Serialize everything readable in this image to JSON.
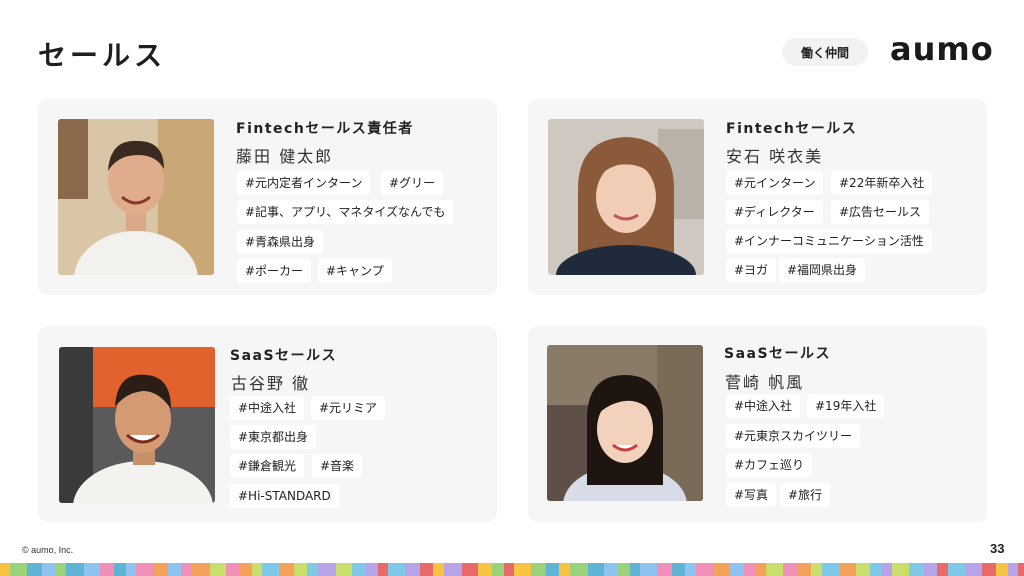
{
  "header": {
    "title": "セールス",
    "nav_pill": "働く仲間",
    "logo": "aumo"
  },
  "members": [
    {
      "role": "Fintechセールス責任者",
      "name": "藤田 健太郎",
      "tags": [
        "#元内定者インターン",
        "#グリー",
        "#記事、アプリ、マネタイズなんでも",
        "#青森県出身",
        "#ポーカー",
        "#キャンプ"
      ]
    },
    {
      "role": "Fintechセールス",
      "name": "安石 咲衣美",
      "tags": [
        "#元インターン",
        "#22年新卒入社",
        "#ディレクター",
        "#広告セールス",
        "#インナーコミュニケーション活性",
        "#ヨガ",
        "#福岡県出身"
      ]
    },
    {
      "role": "SaaSセールス",
      "name": "古谷野 徹",
      "tags": [
        "#中途入社",
        "#元リミア",
        "#東京都出身",
        "#鎌倉観光",
        "#音楽",
        "#Hi-STANDARD"
      ]
    },
    {
      "role": "SaaSセールス",
      "name": "菅崎 帆風",
      "tags": [
        "#中途入社",
        "#19年入社",
        "#元東京スカイツリー",
        "#カフェ巡り",
        "#写真",
        "#旅行"
      ]
    }
  ],
  "footer": {
    "copyright": "© aumo, Inc.",
    "page_number": "33"
  },
  "colors": {
    "card_bg": "#f6f6f6",
    "tag_bg": "#ffffff",
    "pill_bg": "#f2f2f2",
    "deco": [
      "#f6c343",
      "#7fc8e8",
      "#f08fb8",
      "#9ad27a",
      "#b7a3e8",
      "#f4a259",
      "#5fb4d6",
      "#e86a6a",
      "#c8e06b",
      "#8ec3f0"
    ]
  }
}
